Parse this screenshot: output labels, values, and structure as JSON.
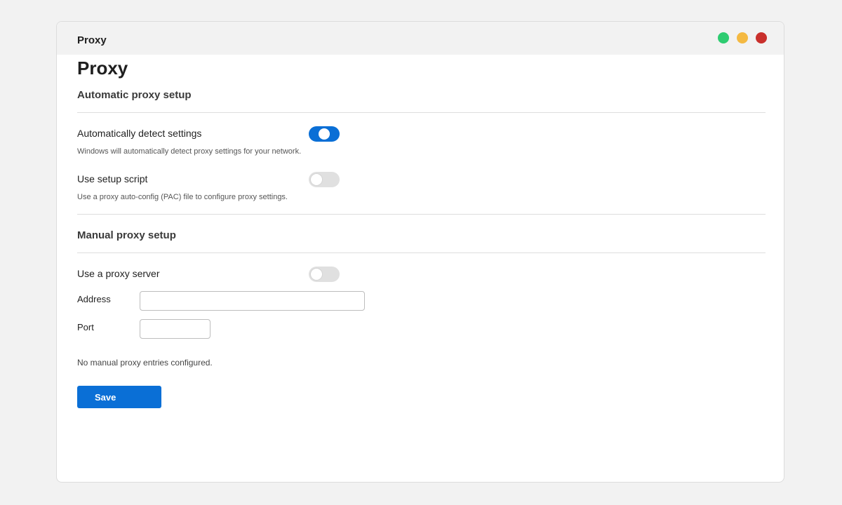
{
  "window": {
    "title": "Proxy",
    "controls": [
      {
        "name": "maximize-control",
        "color": "#2ecc71"
      },
      {
        "name": "minimize-control",
        "color": "#f4b942"
      },
      {
        "name": "close-control",
        "color": "#c9302c"
      }
    ]
  },
  "page": {
    "title": "Proxy"
  },
  "automatic": {
    "heading": "Automatic proxy setup",
    "detect": {
      "label": "Automatically detect settings",
      "description": "Windows will automatically detect proxy settings for your network.",
      "enabled": true
    },
    "script": {
      "label": "Use setup script",
      "description": "Use a proxy auto-config (PAC) file to configure proxy settings.",
      "enabled": false
    }
  },
  "manual": {
    "heading": "Manual proxy setup",
    "use_proxy": {
      "label": "Use a proxy server",
      "enabled": false
    },
    "address": {
      "label": "Address",
      "value": "",
      "placeholder": ""
    },
    "port": {
      "label": "Port",
      "value": "",
      "placeholder": ""
    },
    "status": "No manual proxy entries configured."
  },
  "actions": {
    "save_label": "Save"
  },
  "colors": {
    "accent": "#0a6fd6",
    "toggle_off": "#e0e0e0"
  }
}
